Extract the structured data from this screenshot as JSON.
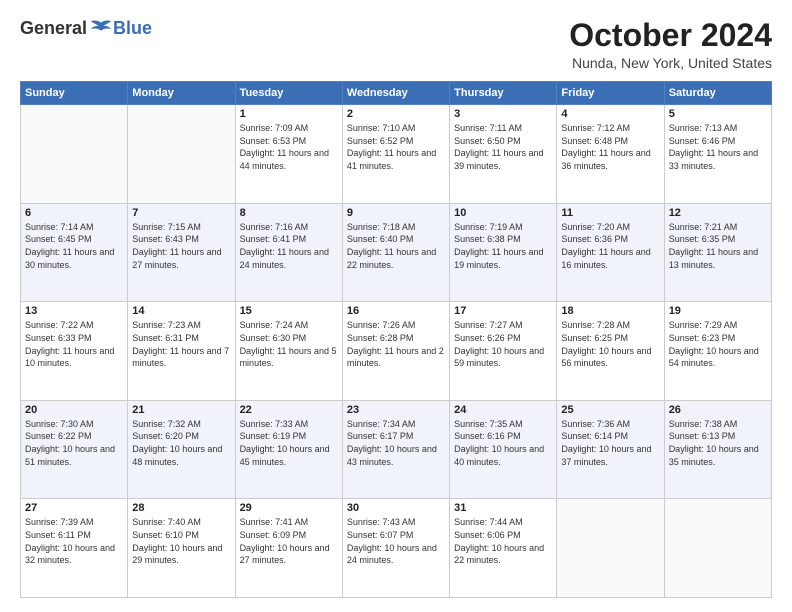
{
  "header": {
    "logo_general": "General",
    "logo_blue": "Blue",
    "title": "October 2024",
    "subtitle": "Nunda, New York, United States"
  },
  "weekdays": [
    "Sunday",
    "Monday",
    "Tuesday",
    "Wednesday",
    "Thursday",
    "Friday",
    "Saturday"
  ],
  "weeks": [
    [
      {
        "day": "",
        "info": ""
      },
      {
        "day": "",
        "info": ""
      },
      {
        "day": "1",
        "info": "Sunrise: 7:09 AM\nSunset: 6:53 PM\nDaylight: 11 hours and 44 minutes."
      },
      {
        "day": "2",
        "info": "Sunrise: 7:10 AM\nSunset: 6:52 PM\nDaylight: 11 hours and 41 minutes."
      },
      {
        "day": "3",
        "info": "Sunrise: 7:11 AM\nSunset: 6:50 PM\nDaylight: 11 hours and 39 minutes."
      },
      {
        "day": "4",
        "info": "Sunrise: 7:12 AM\nSunset: 6:48 PM\nDaylight: 11 hours and 36 minutes."
      },
      {
        "day": "5",
        "info": "Sunrise: 7:13 AM\nSunset: 6:46 PM\nDaylight: 11 hours and 33 minutes."
      }
    ],
    [
      {
        "day": "6",
        "info": "Sunrise: 7:14 AM\nSunset: 6:45 PM\nDaylight: 11 hours and 30 minutes."
      },
      {
        "day": "7",
        "info": "Sunrise: 7:15 AM\nSunset: 6:43 PM\nDaylight: 11 hours and 27 minutes."
      },
      {
        "day": "8",
        "info": "Sunrise: 7:16 AM\nSunset: 6:41 PM\nDaylight: 11 hours and 24 minutes."
      },
      {
        "day": "9",
        "info": "Sunrise: 7:18 AM\nSunset: 6:40 PM\nDaylight: 11 hours and 22 minutes."
      },
      {
        "day": "10",
        "info": "Sunrise: 7:19 AM\nSunset: 6:38 PM\nDaylight: 11 hours and 19 minutes."
      },
      {
        "day": "11",
        "info": "Sunrise: 7:20 AM\nSunset: 6:36 PM\nDaylight: 11 hours and 16 minutes."
      },
      {
        "day": "12",
        "info": "Sunrise: 7:21 AM\nSunset: 6:35 PM\nDaylight: 11 hours and 13 minutes."
      }
    ],
    [
      {
        "day": "13",
        "info": "Sunrise: 7:22 AM\nSunset: 6:33 PM\nDaylight: 11 hours and 10 minutes."
      },
      {
        "day": "14",
        "info": "Sunrise: 7:23 AM\nSunset: 6:31 PM\nDaylight: 11 hours and 7 minutes."
      },
      {
        "day": "15",
        "info": "Sunrise: 7:24 AM\nSunset: 6:30 PM\nDaylight: 11 hours and 5 minutes."
      },
      {
        "day": "16",
        "info": "Sunrise: 7:26 AM\nSunset: 6:28 PM\nDaylight: 11 hours and 2 minutes."
      },
      {
        "day": "17",
        "info": "Sunrise: 7:27 AM\nSunset: 6:26 PM\nDaylight: 10 hours and 59 minutes."
      },
      {
        "day": "18",
        "info": "Sunrise: 7:28 AM\nSunset: 6:25 PM\nDaylight: 10 hours and 56 minutes."
      },
      {
        "day": "19",
        "info": "Sunrise: 7:29 AM\nSunset: 6:23 PM\nDaylight: 10 hours and 54 minutes."
      }
    ],
    [
      {
        "day": "20",
        "info": "Sunrise: 7:30 AM\nSunset: 6:22 PM\nDaylight: 10 hours and 51 minutes."
      },
      {
        "day": "21",
        "info": "Sunrise: 7:32 AM\nSunset: 6:20 PM\nDaylight: 10 hours and 48 minutes."
      },
      {
        "day": "22",
        "info": "Sunrise: 7:33 AM\nSunset: 6:19 PM\nDaylight: 10 hours and 45 minutes."
      },
      {
        "day": "23",
        "info": "Sunrise: 7:34 AM\nSunset: 6:17 PM\nDaylight: 10 hours and 43 minutes."
      },
      {
        "day": "24",
        "info": "Sunrise: 7:35 AM\nSunset: 6:16 PM\nDaylight: 10 hours and 40 minutes."
      },
      {
        "day": "25",
        "info": "Sunrise: 7:36 AM\nSunset: 6:14 PM\nDaylight: 10 hours and 37 minutes."
      },
      {
        "day": "26",
        "info": "Sunrise: 7:38 AM\nSunset: 6:13 PM\nDaylight: 10 hours and 35 minutes."
      }
    ],
    [
      {
        "day": "27",
        "info": "Sunrise: 7:39 AM\nSunset: 6:11 PM\nDaylight: 10 hours and 32 minutes."
      },
      {
        "day": "28",
        "info": "Sunrise: 7:40 AM\nSunset: 6:10 PM\nDaylight: 10 hours and 29 minutes."
      },
      {
        "day": "29",
        "info": "Sunrise: 7:41 AM\nSunset: 6:09 PM\nDaylight: 10 hours and 27 minutes."
      },
      {
        "day": "30",
        "info": "Sunrise: 7:43 AM\nSunset: 6:07 PM\nDaylight: 10 hours and 24 minutes."
      },
      {
        "day": "31",
        "info": "Sunrise: 7:44 AM\nSunset: 6:06 PM\nDaylight: 10 hours and 22 minutes."
      },
      {
        "day": "",
        "info": ""
      },
      {
        "day": "",
        "info": ""
      }
    ]
  ]
}
